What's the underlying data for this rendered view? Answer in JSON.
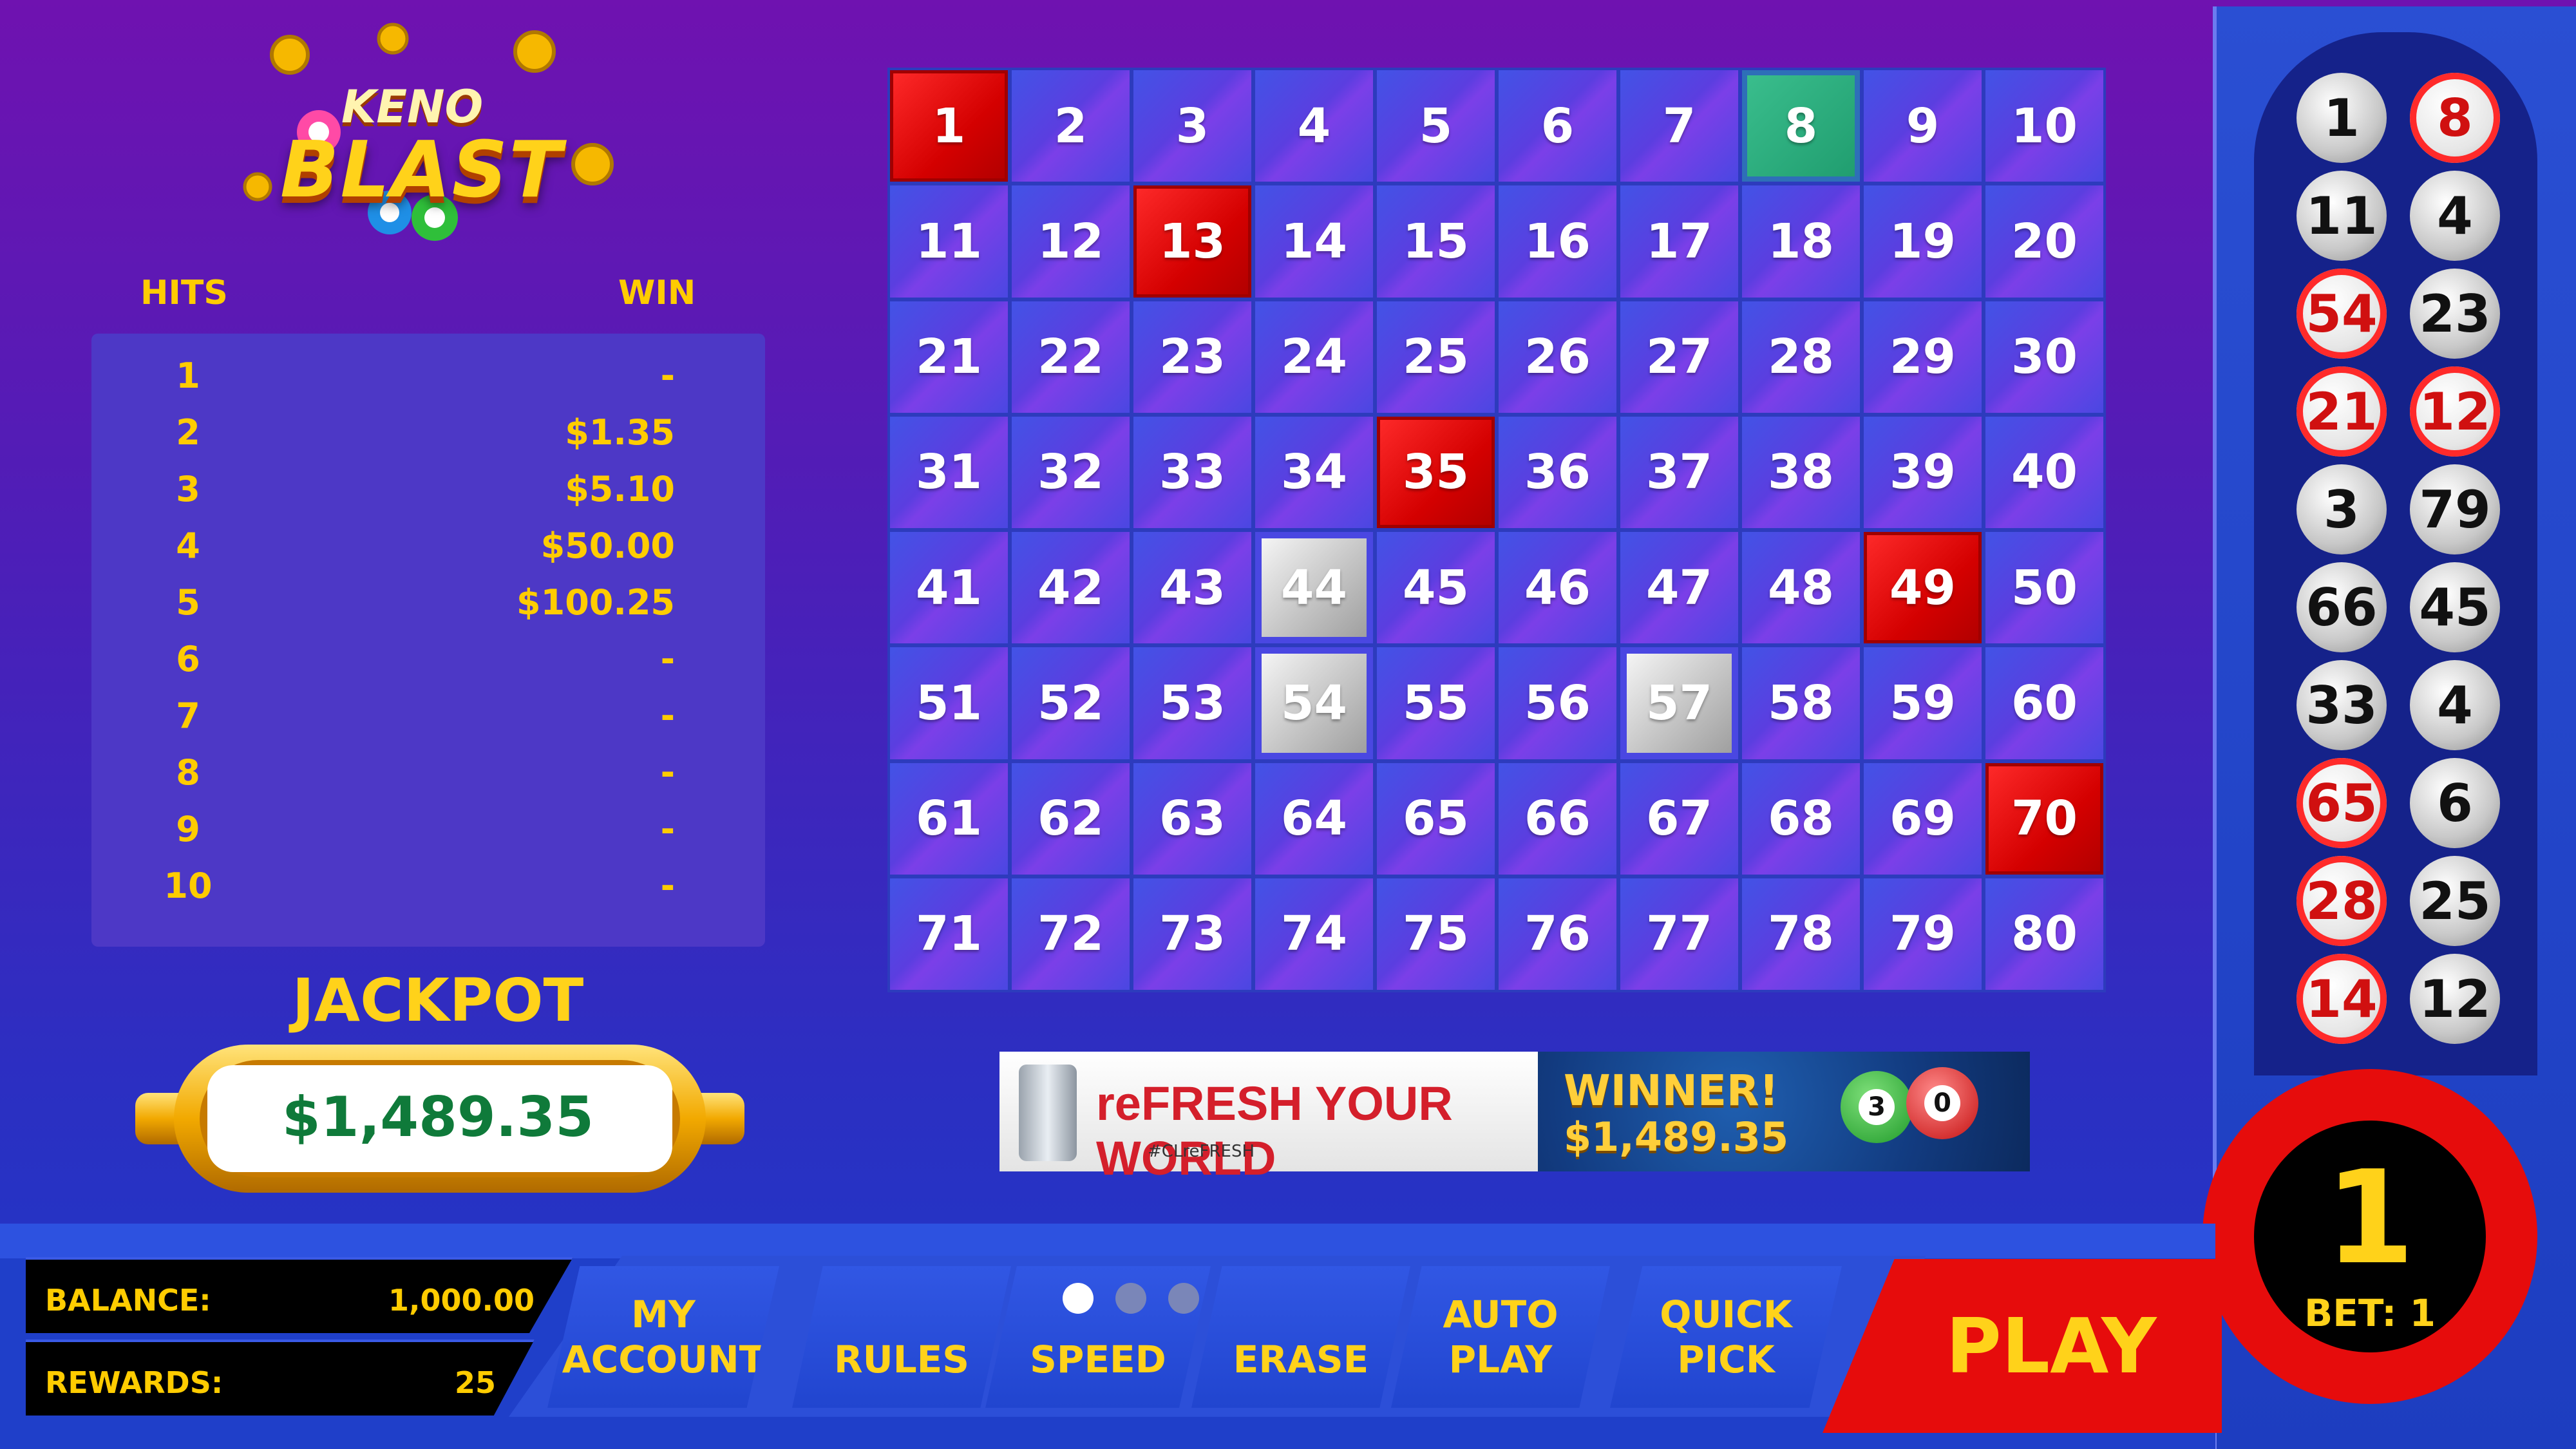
{
  "logo": {
    "line1": "KENO",
    "line2": "BLAST"
  },
  "paytable": {
    "hits_header": "HITS",
    "win_header": "WIN",
    "rows": [
      {
        "hits": "1",
        "win": "-"
      },
      {
        "hits": "2",
        "win": "$1.35"
      },
      {
        "hits": "3",
        "win": "$5.10"
      },
      {
        "hits": "4",
        "win": "$50.00"
      },
      {
        "hits": "5",
        "win": "$100.25"
      },
      {
        "hits": "6",
        "win": "-"
      },
      {
        "hits": "7",
        "win": "-"
      },
      {
        "hits": "8",
        "win": "-"
      },
      {
        "hits": "9",
        "win": "-"
      },
      {
        "hits": "10",
        "win": "-"
      }
    ]
  },
  "jackpot": {
    "title": "JACKPOT",
    "amount": "$1,489.35"
  },
  "board": {
    "numbers": [
      1,
      2,
      3,
      4,
      5,
      6,
      7,
      8,
      9,
      10,
      11,
      12,
      13,
      14,
      15,
      16,
      17,
      18,
      19,
      20,
      21,
      22,
      23,
      24,
      25,
      26,
      27,
      28,
      29,
      30,
      31,
      32,
      33,
      34,
      35,
      36,
      37,
      38,
      39,
      40,
      41,
      42,
      43,
      44,
      45,
      46,
      47,
      48,
      49,
      50,
      51,
      52,
      53,
      54,
      55,
      56,
      57,
      58,
      59,
      60,
      61,
      62,
      63,
      64,
      65,
      66,
      67,
      68,
      69,
      70,
      71,
      72,
      73,
      74,
      75,
      76,
      77,
      78,
      79,
      80
    ],
    "hit_numbers": [
      1,
      13,
      35,
      49,
      70
    ],
    "selected_numbers": [
      8
    ],
    "drawn_numbers": [
      44,
      54,
      57
    ]
  },
  "banner": {
    "headline": "reFRESH YOUR WORLD",
    "tagline": "#CLreFRESH",
    "winner_label": "WINNER!",
    "winner_amount": "$1,489.35",
    "balls": [
      "3",
      "0"
    ]
  },
  "drawn_balls": [
    {
      "n": "1",
      "style": "grey"
    },
    {
      "n": "8",
      "style": "white"
    },
    {
      "n": "11",
      "style": "grey"
    },
    {
      "n": "4",
      "style": "grey"
    },
    {
      "n": "54",
      "style": "white"
    },
    {
      "n": "23",
      "style": "grey"
    },
    {
      "n": "21",
      "style": "white"
    },
    {
      "n": "12",
      "style": "white"
    },
    {
      "n": "3",
      "style": "grey"
    },
    {
      "n": "79",
      "style": "grey"
    },
    {
      "n": "66",
      "style": "grey"
    },
    {
      "n": "45",
      "style": "grey"
    },
    {
      "n": "33",
      "style": "grey"
    },
    {
      "n": "4",
      "style": "grey"
    },
    {
      "n": "65",
      "style": "white"
    },
    {
      "n": "6",
      "style": "grey"
    },
    {
      "n": "28",
      "style": "white"
    },
    {
      "n": "25",
      "style": "grey"
    },
    {
      "n": "14",
      "style": "white"
    },
    {
      "n": "12",
      "style": "grey"
    }
  ],
  "bet": {
    "number": "1",
    "label": "BET: 1"
  },
  "account": {
    "balance_label": "BALANCE:",
    "balance_value": "1,000.00",
    "rewards_label": "REWARDS:",
    "rewards_value": "25"
  },
  "menu": {
    "my_account_1": "MY",
    "my_account_2": "ACCOUNT",
    "rules": "RULES",
    "speed": "SPEED",
    "erase": "ERASE",
    "auto_play_1": "AUTO",
    "auto_play_2": "PLAY",
    "quick_pick_1": "QUICK",
    "quick_pick_2": "PICK",
    "play": "PLAY",
    "speed_level": 1,
    "speed_levels": 3
  },
  "colors": {
    "accent_yellow": "#ffd21a",
    "hit_red": "#e60c0c",
    "cell_blue": "#4a47e2",
    "selected_green": "#1f9c6e"
  }
}
